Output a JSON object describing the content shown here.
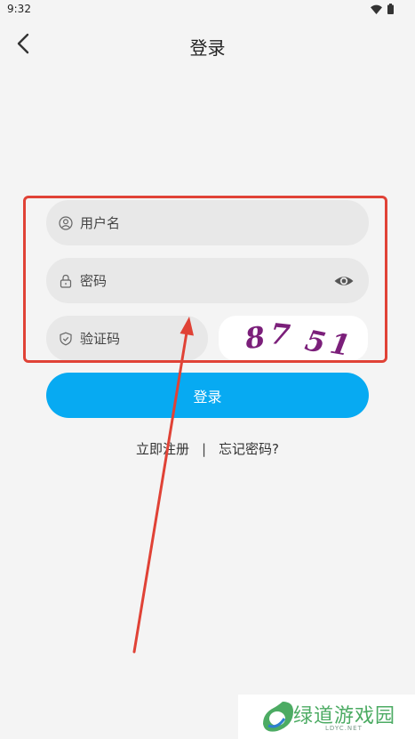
{
  "status_bar": {
    "time": "9:32"
  },
  "header": {
    "title": "登录"
  },
  "form": {
    "username_placeholder": "用户名",
    "password_placeholder": "密码",
    "captcha_placeholder": "验证码",
    "captcha_text": "8751"
  },
  "login_button": "登录",
  "links": {
    "register": "立即注册",
    "separator": "|",
    "forgot": "忘记密码?"
  },
  "watermark": {
    "text": "绿道游戏园",
    "sub": "LDYC.NET"
  },
  "colors": {
    "accent": "#07aaf2",
    "highlight": "#e04236",
    "captcha": "#7b1f7a"
  }
}
